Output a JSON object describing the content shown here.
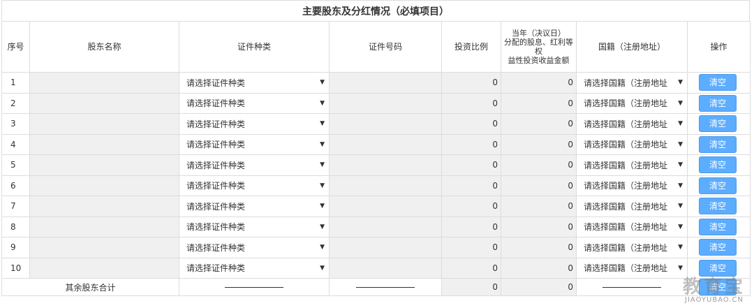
{
  "title": "主要股东及分红情况（必填项目）",
  "headers": {
    "index": "序号",
    "name": "股东名称",
    "id_type": "证件种类",
    "id_number": "证件号码",
    "ratio": "投资比例",
    "dividend_line1": "当年（决议日）",
    "dividend_line2": "分配的股息、红利等权",
    "dividend_line3": "益性投资收益金额",
    "nationality": "国籍（注册地址）",
    "action": "操作"
  },
  "rows": [
    {
      "index": "1",
      "id_type": "请选择证件种类",
      "ratio": "0",
      "dividend": "0",
      "nationality": "请选择国籍（注册地址",
      "action": "清空"
    },
    {
      "index": "2",
      "id_type": "请选择证件种类",
      "ratio": "0",
      "dividend": "0",
      "nationality": "请选择国籍（注册地址",
      "action": "清空"
    },
    {
      "index": "3",
      "id_type": "请选择证件种类",
      "ratio": "0",
      "dividend": "0",
      "nationality": "请选择国籍（注册地址",
      "action": "清空"
    },
    {
      "index": "4",
      "id_type": "请选择证件种类",
      "ratio": "0",
      "dividend": "0",
      "nationality": "请选择国籍（注册地址",
      "action": "清空"
    },
    {
      "index": "5",
      "id_type": "请选择证件种类",
      "ratio": "0",
      "dividend": "0",
      "nationality": "请选择国籍（注册地址",
      "action": "清空"
    },
    {
      "index": "6",
      "id_type": "请选择证件种类",
      "ratio": "0",
      "dividend": "0",
      "nationality": "请选择国籍（注册地址",
      "action": "清空"
    },
    {
      "index": "7",
      "id_type": "请选择证件种类",
      "ratio": "0",
      "dividend": "0",
      "nationality": "请选择国籍（注册地址",
      "action": "清空"
    },
    {
      "index": "8",
      "id_type": "请选择证件种类",
      "ratio": "0",
      "dividend": "0",
      "nationality": "请选择国籍（注册地址",
      "action": "清空"
    },
    {
      "index": "9",
      "id_type": "请选择证件种类",
      "ratio": "0",
      "dividend": "0",
      "nationality": "请选择国籍（注册地址",
      "action": "清空"
    },
    {
      "index": "10",
      "id_type": "请选择证件种类",
      "ratio": "0",
      "dividend": "0",
      "nationality": "请选择国籍（注册地址",
      "action": "清空"
    }
  ],
  "summary": {
    "label": "其余股东合计",
    "ratio": "0",
    "dividend": "0",
    "action": "清空"
  },
  "watermark": {
    "text": "教育宝",
    "url": "JIAOYUBAO.CN"
  },
  "icons": {
    "dropdown": "caret-down-icon"
  },
  "colors": {
    "button": "#5cadff",
    "readonly_cell": "#f0f0f0",
    "border": "#dcdcdc"
  }
}
